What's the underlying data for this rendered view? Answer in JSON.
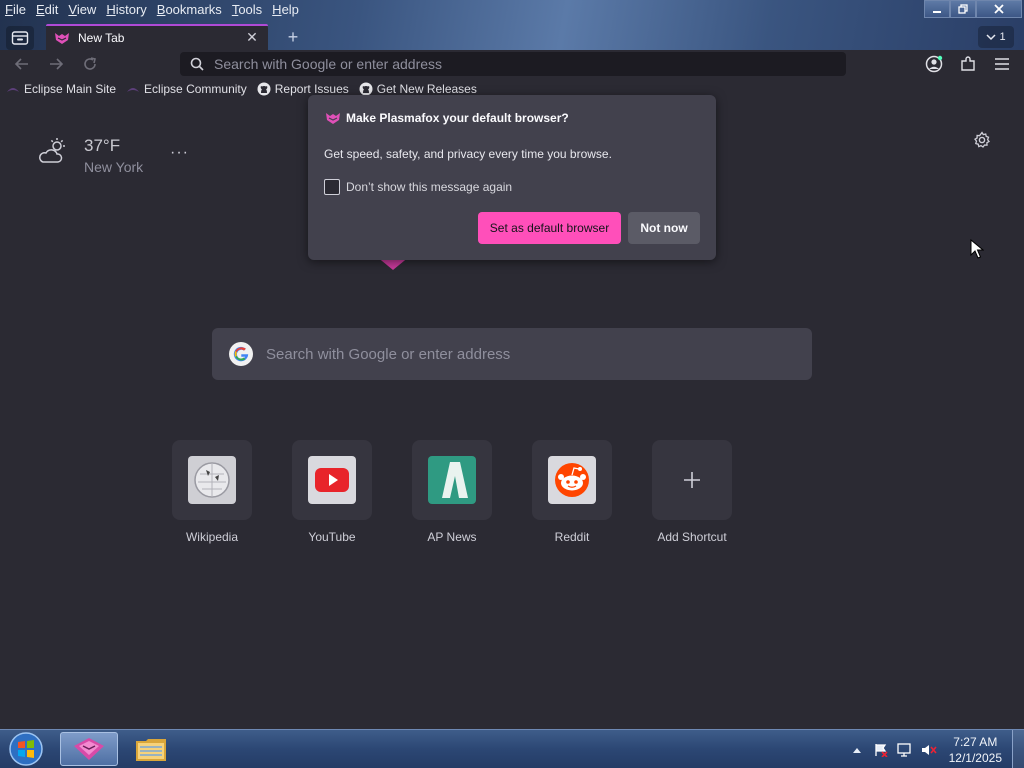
{
  "menubar": {
    "items": [
      {
        "accel": "F",
        "rest": "ile"
      },
      {
        "accel": "E",
        "rest": "dit"
      },
      {
        "accel": "V",
        "rest": "iew"
      },
      {
        "accel": "H",
        "rest": "istory"
      },
      {
        "accel": "B",
        "rest": "ookmarks"
      },
      {
        "accel": "T",
        "rest": "ools"
      },
      {
        "accel": "H",
        "rest": "elp"
      }
    ]
  },
  "tabs": {
    "active_title": "New Tab",
    "overflow_count": "1"
  },
  "urlbar": {
    "placeholder": "Search with Google or enter address"
  },
  "bookmarks": [
    {
      "label": "Eclipse Main Site",
      "icon": "eclipse-icon"
    },
    {
      "label": "Eclipse Community",
      "icon": "eclipse-icon"
    },
    {
      "label": "Report Issues",
      "icon": "github-icon"
    },
    {
      "label": "Get New Releases",
      "icon": "github-icon"
    }
  ],
  "weather": {
    "temperature": "37°F",
    "city": "New York",
    "icon": "partly-cloudy-icon",
    "more": "···"
  },
  "search": {
    "placeholder": "Search with Google or enter address"
  },
  "shortcuts": [
    {
      "label": "Wikipedia",
      "icon": "wikipedia-icon"
    },
    {
      "label": "YouTube",
      "icon": "youtube-icon"
    },
    {
      "label": "AP News",
      "icon": "ap-news-icon"
    },
    {
      "label": "Reddit",
      "icon": "reddit-icon"
    },
    {
      "label": "Add Shortcut",
      "icon": "plus-icon"
    }
  ],
  "popup": {
    "title": "Make Plasmafox your default browser?",
    "message": "Get speed, safety, and privacy every time you browse.",
    "checkbox_label": "Don’t show this message again",
    "checkbox_checked": false,
    "primary_button": "Set as default browser",
    "secondary_button": "Not now"
  },
  "taskbar": {
    "time": "7:27 AM",
    "date": "12/1/2025"
  },
  "colors": {
    "accent": "#ff4fba",
    "background": "#2b2a33",
    "popup_bg": "#42414d"
  }
}
